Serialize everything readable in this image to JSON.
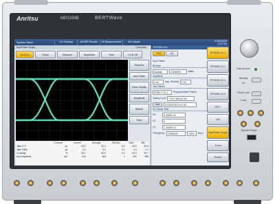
{
  "device": {
    "brand": "Anritsu",
    "model": "MP2100B",
    "product": "BERTWave"
  },
  "topbar": {
    "system_menu": "System Menu",
    "tabs": [
      "Ch Tracking",
      "All BER Results",
      "All Measurements",
      "All Outputs"
    ],
    "clock_date": "07/02/2019",
    "clock_time": "14:07:54"
  },
  "scope": {
    "title": "Eye/Pulse Scope",
    "sample": "Complete",
    "buttons": [
      "Ch A Ch",
      "Setup",
      "Measure",
      "Amplitude",
      "Time",
      "Ch B Off"
    ],
    "side_buttons": [
      "Time/Div",
      "Auto Scale",
      "Clear Display",
      "Amplitude",
      "Marker",
      "Save"
    ],
    "meas_headers": [
      "Channel",
      "Current",
      "Average",
      "Std Dev",
      "Max",
      "Min"
    ],
    "meas_rows": [
      {
        "label": "Jitter P-P",
        "values": [
          "ps",
          "33.1",
          "33.4",
          "0.4",
          "34.0",
          "32.8"
        ]
      },
      {
        "label": "Jitter RMS",
        "values": [
          "ps",
          "3.2",
          "3.2",
          "0.1",
          "3.4",
          "3.1"
        ]
      },
      {
        "label": "Crossing",
        "values": [
          "%",
          "50.1",
          "50.0",
          "0.2",
          "50.4",
          "49.7"
        ]
      },
      {
        "label": "Eye Amplitude",
        "values": [
          "mV",
          "400",
          "400",
          "1",
          "402",
          "398"
        ]
      }
    ]
  },
  "ppg": {
    "title": "PPG/ED Ch1",
    "tabs": [
      "PPG",
      "ED"
    ],
    "main_button": "Main",
    "sync_label": "Sync Offset",
    "bitrate_label": "Bit Rate",
    "bitrate_value": "12500000",
    "bitrate_unit": "kbit/s",
    "variable_label": "Variable",
    "amplitude_label": "Amplitude",
    "amplitude_value": "0.40",
    "amplitude_unit": "Vpp",
    "relative_label": "Relative",
    "relative_value": "0.00",
    "test_pattern_label": "Test Pattern",
    "test_pattern_value": "PRBS 2^31-1",
    "programmable": "Programmable Pattern",
    "gating_label": "Gating Cycle",
    "start_label": "Start",
    "cycle_value": "7 547 483 647 bit",
    "datetime_value": "07/02/2019 14:07:54",
    "result_label": "ED Result Total",
    "er_label": "ER",
    "er_value": "0.0000E-10",
    "ec_label": "EC",
    "ec_value": "0",
    "cc_label": "CC",
    "cc_value": "1.2000E+10",
    "freq_label": "FREQ(kHz)",
    "freq_value": "12500000",
    "error_label": "Error",
    "error_value": "100%"
  },
  "right_buttons": [
    "PPG/ED Ch 1",
    "PPG/ED Ch 2",
    "PPG/ED Ch 3",
    "PPG/ED Ch 4",
    "SFP+",
    "O/E",
    "Eye/Pulse Scope",
    "Trans",
    "Result"
  ],
  "hardware": {
    "knob_label": "Disk Access",
    "standby": "Standby",
    "on": "On",
    "panel_lock": "Panel Lock",
    "local": "Local",
    "optical_pulses": "Optical Pulses"
  },
  "colors": {
    "screen_accent": "#3a5e96",
    "eye_trace": "#1dd0c8",
    "eye_trace_hot": "#f0e27a",
    "active_button": "#f2b800"
  }
}
